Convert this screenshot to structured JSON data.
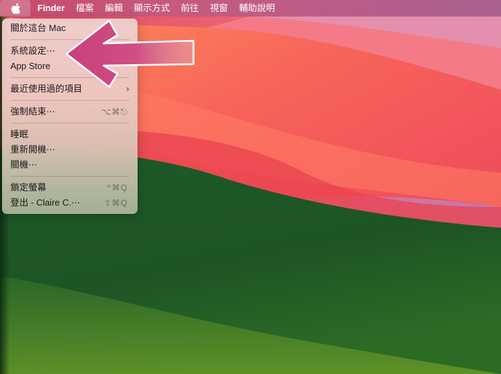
{
  "menubar": {
    "apple_icon": "apple-logo-icon",
    "app_name": "Finder",
    "menus": [
      "檔案",
      "編輯",
      "顯示方式",
      "前往",
      "視窗",
      "輔助說明"
    ]
  },
  "apple_menu": {
    "about": "關於這台 Mac",
    "system_settings": "系統設定⋯",
    "app_store": "App Store",
    "recent_items": "最近使用過的項目",
    "recent_items_icon": "chevron-right-icon",
    "force_quit": "強制結束⋯",
    "force_quit_shortcut": "⌥⌘⎋",
    "sleep": "睡眠",
    "restart": "重新開機⋯",
    "shut_down": "關機⋯",
    "lock_screen": "鎖定螢幕",
    "lock_screen_shortcut": "^⌘Q",
    "log_out": "登出 - Claire C.⋯",
    "log_out_shortcut": "⇧⌘Q"
  },
  "annotation": {
    "arrow_icon": "pointing-arrow-icon",
    "arrow_color": "#c8407a"
  },
  "colors": {
    "menubar": "#c55a7e",
    "wallpaper_red": "#f25a55",
    "wallpaper_green": "#255f2a"
  }
}
